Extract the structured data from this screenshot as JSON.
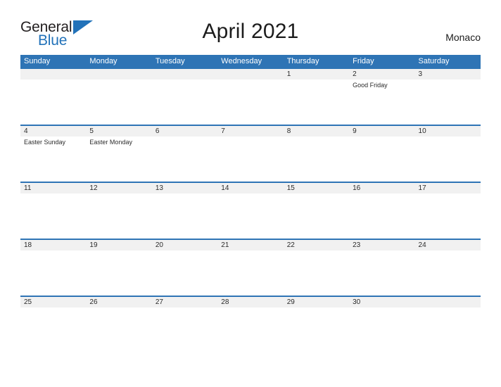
{
  "brand": {
    "name_part1": "General",
    "name_part2": "Blue",
    "triangle_color": "#2272b9"
  },
  "header": {
    "title": "April 2021",
    "region": "Monaco"
  },
  "theme": {
    "header_blue": "#2e74b5",
    "band_gray": "#f1f1f1",
    "text_dark": "#2b2b2b"
  },
  "calendar": {
    "weekdays": [
      "Sunday",
      "Monday",
      "Tuesday",
      "Wednesday",
      "Thursday",
      "Friday",
      "Saturday"
    ],
    "weeks": [
      {
        "days": [
          {
            "num": "",
            "event": ""
          },
          {
            "num": "",
            "event": ""
          },
          {
            "num": "",
            "event": ""
          },
          {
            "num": "",
            "event": ""
          },
          {
            "num": "1",
            "event": ""
          },
          {
            "num": "2",
            "event": "Good Friday"
          },
          {
            "num": "3",
            "event": ""
          }
        ]
      },
      {
        "days": [
          {
            "num": "4",
            "event": "Easter Sunday"
          },
          {
            "num": "5",
            "event": "Easter Monday"
          },
          {
            "num": "6",
            "event": ""
          },
          {
            "num": "7",
            "event": ""
          },
          {
            "num": "8",
            "event": ""
          },
          {
            "num": "9",
            "event": ""
          },
          {
            "num": "10",
            "event": ""
          }
        ]
      },
      {
        "days": [
          {
            "num": "11",
            "event": ""
          },
          {
            "num": "12",
            "event": ""
          },
          {
            "num": "13",
            "event": ""
          },
          {
            "num": "14",
            "event": ""
          },
          {
            "num": "15",
            "event": ""
          },
          {
            "num": "16",
            "event": ""
          },
          {
            "num": "17",
            "event": ""
          }
        ]
      },
      {
        "days": [
          {
            "num": "18",
            "event": ""
          },
          {
            "num": "19",
            "event": ""
          },
          {
            "num": "20",
            "event": ""
          },
          {
            "num": "21",
            "event": ""
          },
          {
            "num": "22",
            "event": ""
          },
          {
            "num": "23",
            "event": ""
          },
          {
            "num": "24",
            "event": ""
          }
        ]
      },
      {
        "days": [
          {
            "num": "25",
            "event": ""
          },
          {
            "num": "26",
            "event": ""
          },
          {
            "num": "27",
            "event": ""
          },
          {
            "num": "28",
            "event": ""
          },
          {
            "num": "29",
            "event": ""
          },
          {
            "num": "30",
            "event": ""
          },
          {
            "num": "",
            "event": ""
          }
        ]
      }
    ]
  }
}
